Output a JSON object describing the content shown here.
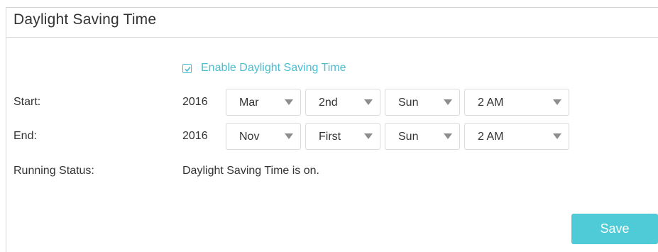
{
  "panel": {
    "title": "Daylight Saving Time"
  },
  "enable": {
    "label": "Enable Daylight Saving Time",
    "checked": true
  },
  "start": {
    "label": "Start:",
    "year": "2016",
    "month": "Mar",
    "week": "2nd",
    "day": "Sun",
    "time": "2 AM"
  },
  "end": {
    "label": "End:",
    "year": "2016",
    "month": "Nov",
    "week": "First",
    "day": "Sun",
    "time": "2 AM"
  },
  "status": {
    "label": "Running Status:",
    "value": "Daylight Saving Time is on."
  },
  "save_label": "Save",
  "colors": {
    "accent": "#4cbdd1",
    "save_button": "#4ecbd6",
    "text": "#333333",
    "border": "#d9d9d9"
  },
  "icons": {
    "checkbox": "checkmark-icon",
    "dropdown": "chevron-down-icon"
  }
}
